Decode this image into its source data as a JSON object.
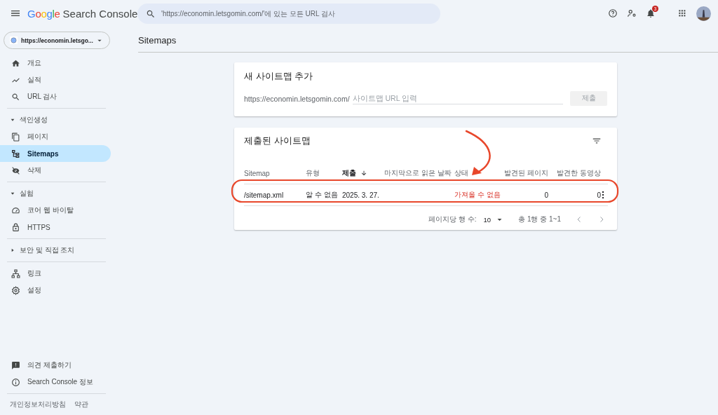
{
  "header": {
    "logo": "Google",
    "product": "Search Console",
    "search": {
      "placeholder": "'https://economin.letsgomin.com/'에 있는 모든 URL 검사"
    },
    "notification_count": "3"
  },
  "sidebar": {
    "property": "https://economin.letsgo...",
    "groups": [
      {
        "items": [
          {
            "label": "개요",
            "selected": false
          },
          {
            "label": "실적",
            "selected": false
          },
          {
            "label": "URL 검사",
            "selected": false
          }
        ]
      },
      {
        "heading": "색인생성",
        "expanded": true,
        "items": [
          {
            "label": "페이지",
            "selected": false
          },
          {
            "label": "Sitemaps",
            "selected": true
          },
          {
            "label": "삭제",
            "selected": false
          }
        ]
      },
      {
        "heading": "실험",
        "expanded": true,
        "items": [
          {
            "label": "코어 웹 바이탈",
            "selected": false
          },
          {
            "label": "HTTPS",
            "selected": false
          }
        ]
      },
      {
        "heading": "보안 및 직접 조치",
        "expanded": false
      },
      {
        "items": [
          {
            "label": "링크",
            "selected": false
          },
          {
            "label": "설정",
            "selected": false
          }
        ]
      }
    ],
    "footer_items": [
      "의견 제출하기",
      "Search Console 정보"
    ],
    "footer_links": [
      "개인정보처리방침",
      "약관"
    ]
  },
  "page_title": "Sitemaps",
  "add_sitemap": {
    "title": "새 사이트맵 추가",
    "url_prefix": "https://economin.letsgomin.com/",
    "placeholder": "사이트맵 URL 입력",
    "button": {
      "label": "제출",
      "disabled": true
    }
  },
  "submitted_sitemaps": {
    "title": "제출된 사이트맵",
    "columns": [
      {
        "label": "Sitemap",
        "sorted": false
      },
      {
        "label": "유형",
        "sorted": false
      },
      {
        "label": "제출",
        "sorted": true
      },
      {
        "label": "마지막으로 읽은 날짜",
        "sorted": false
      },
      {
        "label": "상태",
        "sorted": false
      },
      {
        "label": "발견된 페이지",
        "sorted": false
      },
      {
        "label": "발견한 동영상",
        "sorted": false
      }
    ],
    "rows": [
      {
        "sitemap": "/sitemap.xml",
        "type": "알 수 없음",
        "submitted": "2025. 3. 27.",
        "status": "가져올 수 없음",
        "discovered_pages": "0",
        "discovered_videos": "0",
        "circled": true,
        "arrow_to_status": true
      }
    ],
    "pagination": {
      "rows_per_page_label": "페이지당 행 수:",
      "rows_per_page": "10",
      "range": "총 1행 중 1~1"
    }
  }
}
